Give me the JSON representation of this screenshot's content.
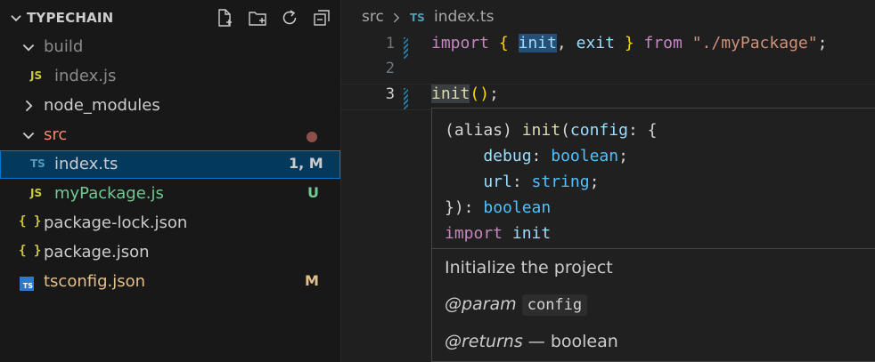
{
  "explorer": {
    "title": "TYPECHAIN",
    "actions": [
      "new-file-icon",
      "new-folder-icon",
      "refresh-icon",
      "collapse-all-icon"
    ],
    "items": [
      {
        "label": "build",
        "type": "folder",
        "expanded": true,
        "badge": ""
      },
      {
        "label": "index.js",
        "type": "file",
        "icon_text": "JS",
        "badge": ""
      },
      {
        "label": "node_modules",
        "type": "folder",
        "expanded": false,
        "badge": ""
      },
      {
        "label": "src",
        "type": "folder",
        "expanded": true,
        "badge": ""
      },
      {
        "label": "index.ts",
        "type": "file",
        "icon_text": "TS",
        "badge": "1, M",
        "selected": true
      },
      {
        "label": "myPackage.js",
        "type": "file",
        "icon_text": "JS",
        "badge": "U"
      },
      {
        "label": "package-lock.json",
        "type": "file",
        "icon_text": "{ }",
        "badge": ""
      },
      {
        "label": "package.json",
        "type": "file",
        "icon_text": "{ }",
        "badge": ""
      },
      {
        "label": "tsconfig.json",
        "type": "file",
        "icon_text": "TS",
        "badge": "M"
      }
    ]
  },
  "colors": {
    "modified": "#e2c08d",
    "untracked": "#73c991",
    "error_folder": "#f48771",
    "selected_bg": "#04395e",
    "focus_border": "#0078d4"
  },
  "breadcrumb": {
    "folder": "src",
    "file_icon": "TS",
    "file": "index.ts"
  },
  "editor": {
    "lines": [
      {
        "number": "1",
        "tokens": [
          {
            "text": "import",
            "cls": "kw"
          },
          {
            "text": " ",
            "cls": "op"
          },
          {
            "text": "{",
            "cls": "br"
          },
          {
            "text": " ",
            "cls": "op"
          },
          {
            "text": "init",
            "cls": "plain"
          },
          {
            "text": ", ",
            "cls": "op"
          },
          {
            "text": "exit",
            "cls": "plain"
          },
          {
            "text": " ",
            "cls": "op"
          },
          {
            "text": "}",
            "cls": "br"
          },
          {
            "text": " ",
            "cls": "op"
          },
          {
            "text": "from",
            "cls": "kw"
          },
          {
            "text": " ",
            "cls": "op"
          },
          {
            "text": "\"./myPackage\"",
            "cls": "str"
          },
          {
            "text": ";",
            "cls": "op"
          }
        ]
      },
      {
        "number": "2",
        "tokens": []
      },
      {
        "number": "3",
        "tokens": [
          {
            "text": "init",
            "cls": "fn"
          },
          {
            "text": "()",
            "cls": "br"
          },
          {
            "text": ";",
            "cls": "op"
          }
        ]
      }
    ]
  },
  "hover": {
    "signature_lines": [
      [
        {
          "text": "(alias) ",
          "cls": "op"
        },
        {
          "text": "init",
          "cls": "fn"
        },
        {
          "text": "(",
          "cls": "op"
        },
        {
          "text": "config",
          "cls": "plain"
        },
        {
          "text": ": {",
          "cls": "op"
        }
      ],
      [
        {
          "text": "    debug",
          "cls": "plain"
        },
        {
          "text": ": ",
          "cls": "op"
        },
        {
          "text": "boolean",
          "cls": "var"
        },
        {
          "text": ";",
          "cls": "op"
        }
      ],
      [
        {
          "text": "    url",
          "cls": "plain"
        },
        {
          "text": ": ",
          "cls": "op"
        },
        {
          "text": "string",
          "cls": "var"
        },
        {
          "text": ";",
          "cls": "op"
        }
      ],
      [
        {
          "text": "}): ",
          "cls": "op"
        },
        {
          "text": "boolean",
          "cls": "var"
        }
      ],
      [
        {
          "text": "import",
          "cls": "kw"
        },
        {
          "text": " ",
          "cls": "op"
        },
        {
          "text": "init",
          "cls": "plain"
        }
      ]
    ],
    "description": "Initialize the project",
    "param_tag": "@param",
    "param_name": "config",
    "returns_tag": "@returns",
    "returns_text": "— boolean"
  }
}
